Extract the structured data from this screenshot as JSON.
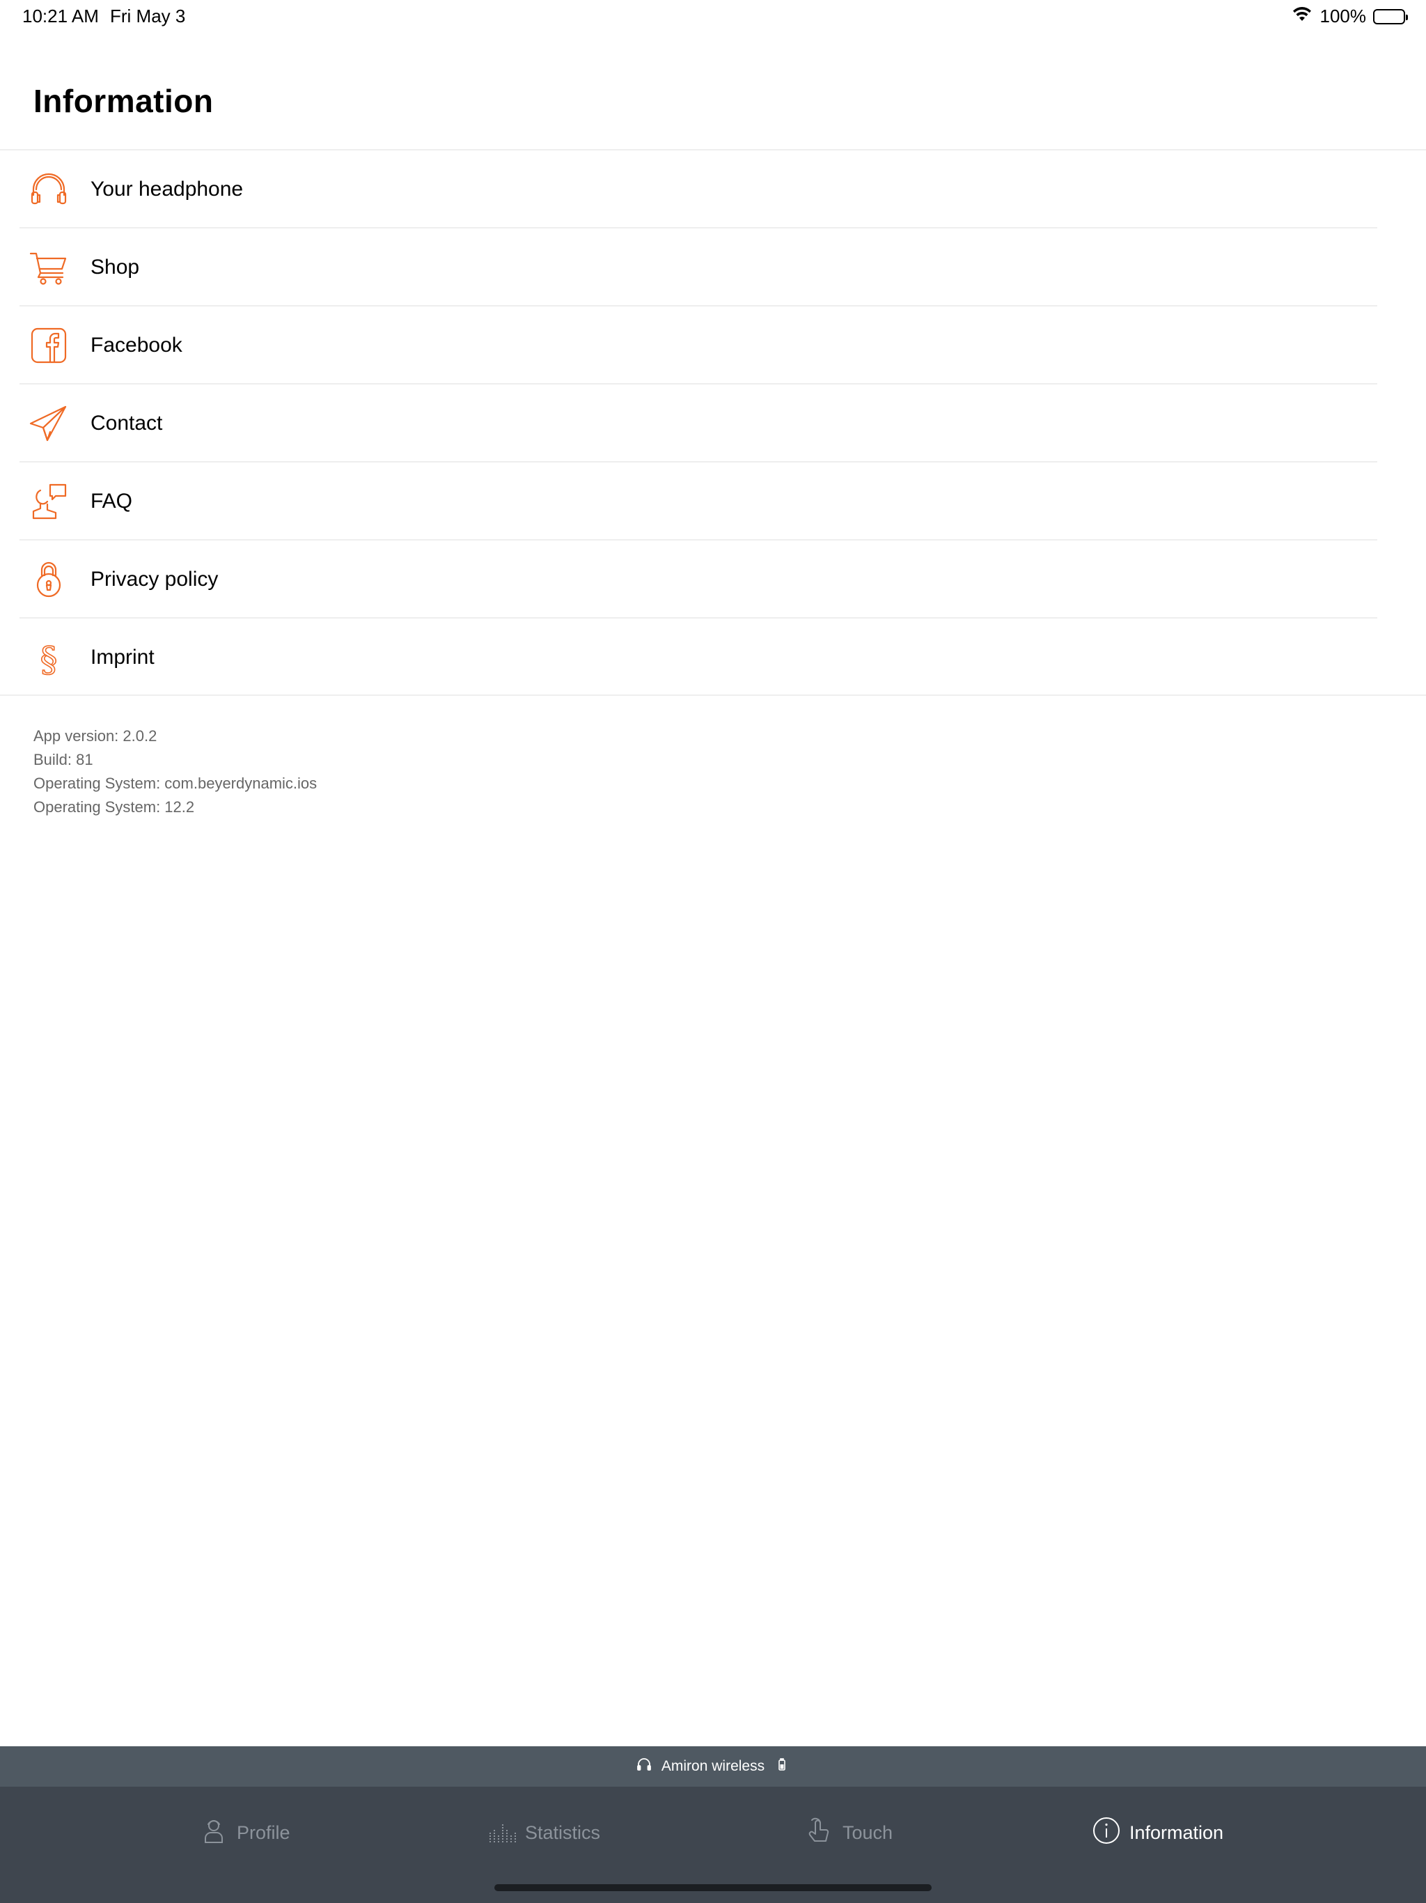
{
  "status_bar": {
    "time": "10:21 AM",
    "date": "Fri May 3",
    "battery_percent": "100%"
  },
  "header": {
    "title": "Information"
  },
  "accent_color": "#ef6a25",
  "menu": {
    "items": [
      {
        "label": "Your headphone",
        "icon": "headphone-icon"
      },
      {
        "label": "Shop",
        "icon": "cart-icon"
      },
      {
        "label": "Facebook",
        "icon": "facebook-icon"
      },
      {
        "label": "Contact",
        "icon": "paper-plane-icon"
      },
      {
        "label": "FAQ",
        "icon": "person-speech-icon"
      },
      {
        "label": "Privacy policy",
        "icon": "lock-icon"
      },
      {
        "label": "Imprint",
        "icon": "section-sign-icon"
      }
    ]
  },
  "app_info": {
    "version": "App version: 2.0.2",
    "build": "Build: 81",
    "os_bundle": "Operating System: com.beyerdynamic.ios",
    "os_version": "Operating System: 12.2"
  },
  "device_bar": {
    "device_name": "Amiron wireless"
  },
  "tab_bar": {
    "tabs": [
      {
        "label": "Profile",
        "icon": "profile-icon",
        "active": false
      },
      {
        "label": "Statistics",
        "icon": "statistics-icon",
        "active": false
      },
      {
        "label": "Touch",
        "icon": "touch-icon",
        "active": false
      },
      {
        "label": "Information",
        "icon": "info-icon",
        "active": true
      }
    ]
  }
}
